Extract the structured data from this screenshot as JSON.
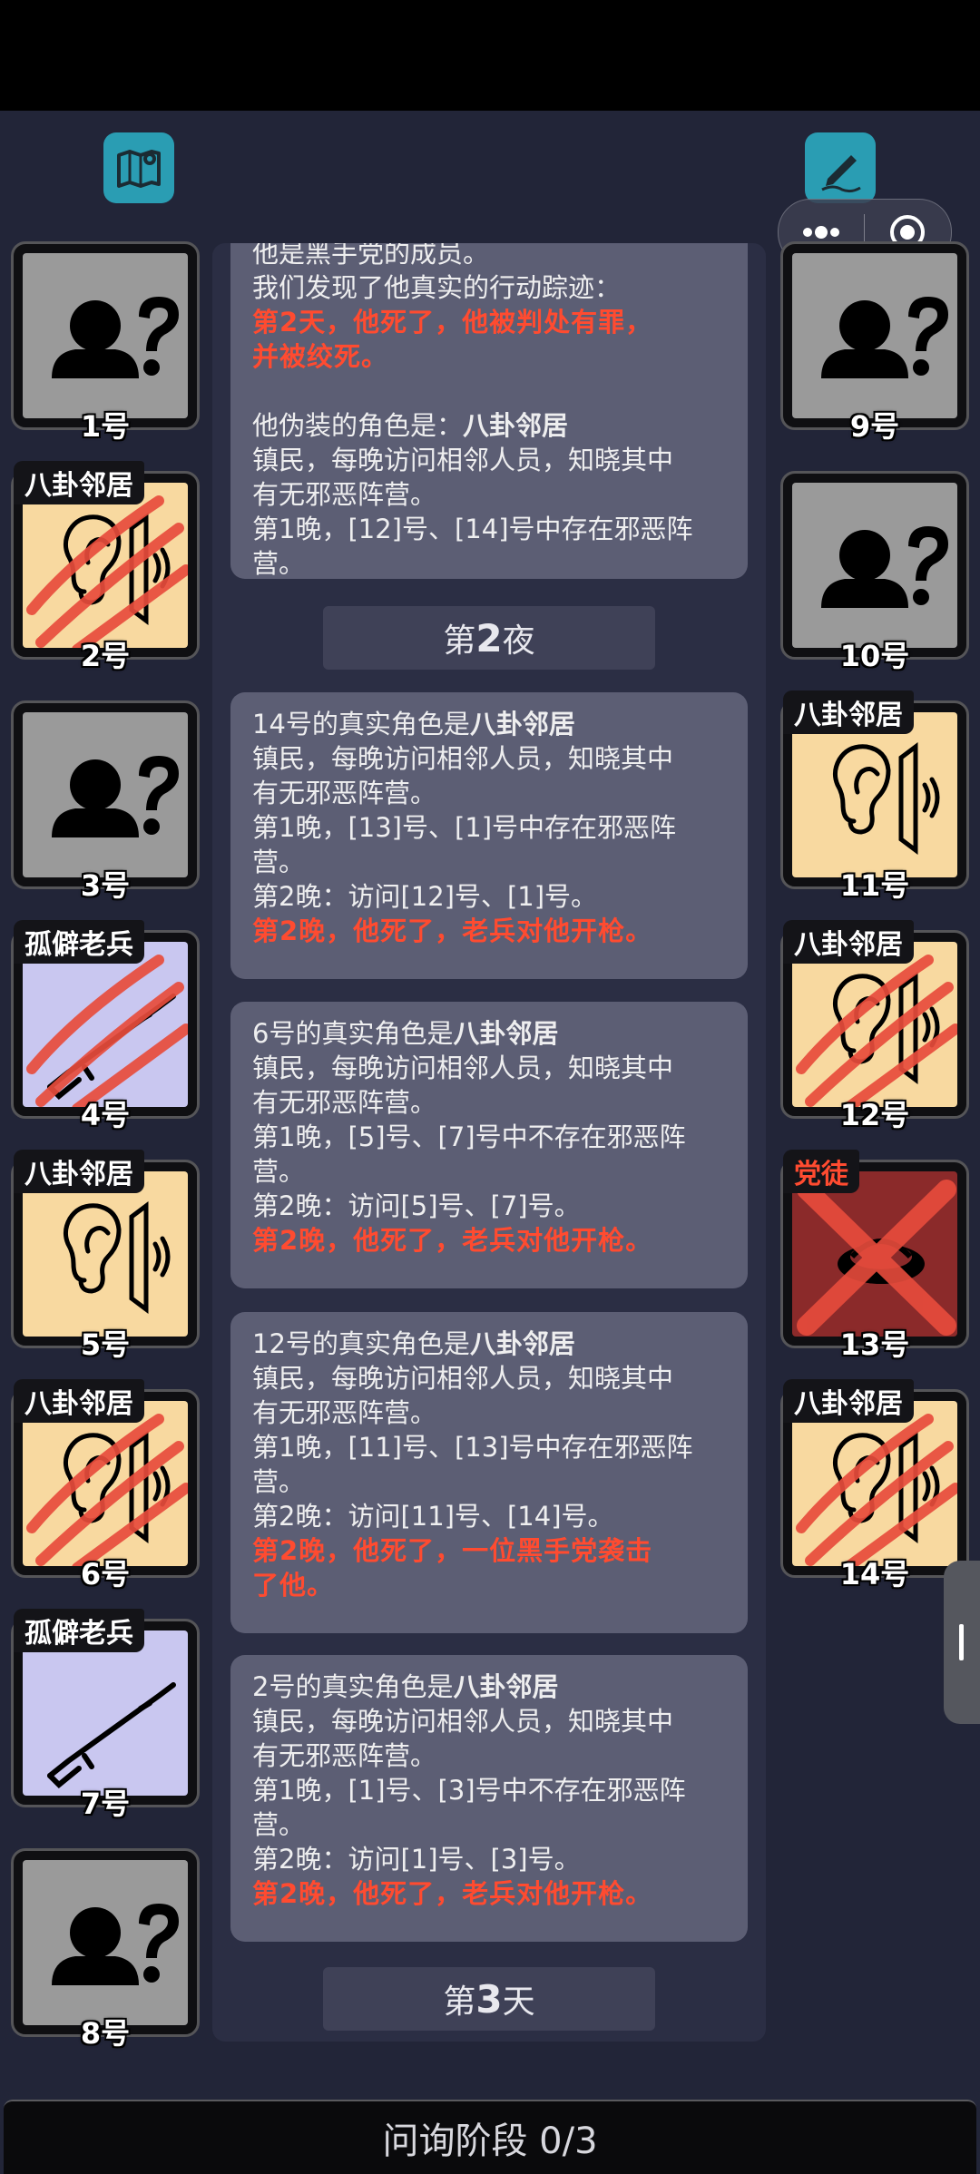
{
  "toolbar": {
    "left_icon": "map-icon",
    "right_icon": "edit-icon"
  },
  "capsule": {
    "more_icon": "more-dots-icon",
    "close_icon": "target-close-icon"
  },
  "log": {
    "top_partial": {
      "line0": "他是黑手党的成员。",
      "line1": "我们发现了他真实的行动踪迹：",
      "red1": "第2天，他死了，他被判处有罪，",
      "red2": "并被绞死。",
      "disguise_prefix": "他伪装的角色是：",
      "disguise_role": "八卦邻居",
      "desc1": "镇民，每晚访问相邻人员，知晓其中",
      "desc2": "有无邪恶阵营。",
      "night1a": "第1晚，[12]号、[14]号中存在邪恶阵",
      "night1b": "营。"
    },
    "phase_night": {
      "prefix": "第",
      "num": "2",
      "suffix": "夜"
    },
    "entries": [
      {
        "title_prefix": "14号的真实角色是",
        "title_role": "八卦邻居",
        "desc1": "镇民，每晚访问相邻人员，知晓其中",
        "desc2": "有无邪恶阵营。",
        "n1a": "第1晚，[13]号、[1]号中存在邪恶阵",
        "n1b": "营。",
        "n2": "第2晚：访问[12]号、[1]号。",
        "death1": "第2晚，他死了，老兵对他开枪。",
        "death2": ""
      },
      {
        "title_prefix": "6号的真实角色是",
        "title_role": "八卦邻居",
        "desc1": "镇民，每晚访问相邻人员，知晓其中",
        "desc2": "有无邪恶阵营。",
        "n1a": "第1晚，[5]号、[7]号中不存在邪恶阵",
        "n1b": "营。",
        "n2": "第2晚：访问[5]号、[7]号。",
        "death1": "第2晚，他死了，老兵对他开枪。",
        "death2": ""
      },
      {
        "title_prefix": "12号的真实角色是",
        "title_role": "八卦邻居",
        "desc1": "镇民，每晚访问相邻人员，知晓其中",
        "desc2": "有无邪恶阵营。",
        "n1a": "第1晚，[11]号、[13]号中存在邪恶阵",
        "n1b": "营。",
        "n2": "第2晚：访问[11]号、[14]号。",
        "death1": "第2晚，他死了，一位黑手党袭击",
        "death2": "了他。"
      },
      {
        "title_prefix": "2号的真实角色是",
        "title_role": "八卦邻居",
        "desc1": "镇民，每晚访问相邻人员，知晓其中",
        "desc2": "有无邪恶阵营。",
        "n1a": "第1晚，[1]号、[3]号中不存在邪恶阵",
        "n1b": "营。",
        "n2": "第2晚：访问[1]号、[3]号。",
        "death1": "第2晚，他死了，老兵对他开枪。",
        "death2": ""
      }
    ],
    "phase_day": {
      "prefix": "第",
      "num": "3",
      "suffix": "天"
    }
  },
  "players": {
    "p1": {
      "num": "1号",
      "role": "",
      "kind": "unknown",
      "dead": false
    },
    "p2": {
      "num": "2号",
      "role": "八卦邻居",
      "kind": "neighbor",
      "dead": true
    },
    "p3": {
      "num": "3号",
      "role": "",
      "kind": "unknown",
      "dead": false
    },
    "p4": {
      "num": "4号",
      "role": "孤僻老兵",
      "kind": "veteran",
      "dead": true
    },
    "p5": {
      "num": "5号",
      "role": "八卦邻居",
      "kind": "neighbor",
      "dead": false
    },
    "p6": {
      "num": "6号",
      "role": "八卦邻居",
      "kind": "neighbor",
      "dead": true
    },
    "p7": {
      "num": "7号",
      "role": "孤僻老兵",
      "kind": "veteran",
      "dead": false
    },
    "p8": {
      "num": "8号",
      "role": "",
      "kind": "unknown",
      "dead": false
    },
    "p9": {
      "num": "9号",
      "role": "",
      "kind": "unknown",
      "dead": false
    },
    "p10": {
      "num": "10号",
      "role": "",
      "kind": "unknown",
      "dead": false
    },
    "p11": {
      "num": "11号",
      "role": "八卦邻居",
      "kind": "neighbor",
      "dead": false
    },
    "p12": {
      "num": "12号",
      "role": "八卦邻居",
      "kind": "neighbor",
      "dead": true
    },
    "p13": {
      "num": "13号",
      "role": "党徒",
      "kind": "zealot",
      "dead": true
    },
    "p14": {
      "num": "14号",
      "role": "八卦邻居",
      "kind": "neighbor",
      "dead": true
    }
  },
  "bottom": {
    "label": "问询阶段 0/3"
  },
  "colors": {
    "death_red": "#ff4b30",
    "neighbor_bg": "#f8d9a0",
    "veteran_bg": "#c9c7f0",
    "unknown_bg": "#9a9a9a",
    "zealot_bg": "#8b2a2a"
  }
}
